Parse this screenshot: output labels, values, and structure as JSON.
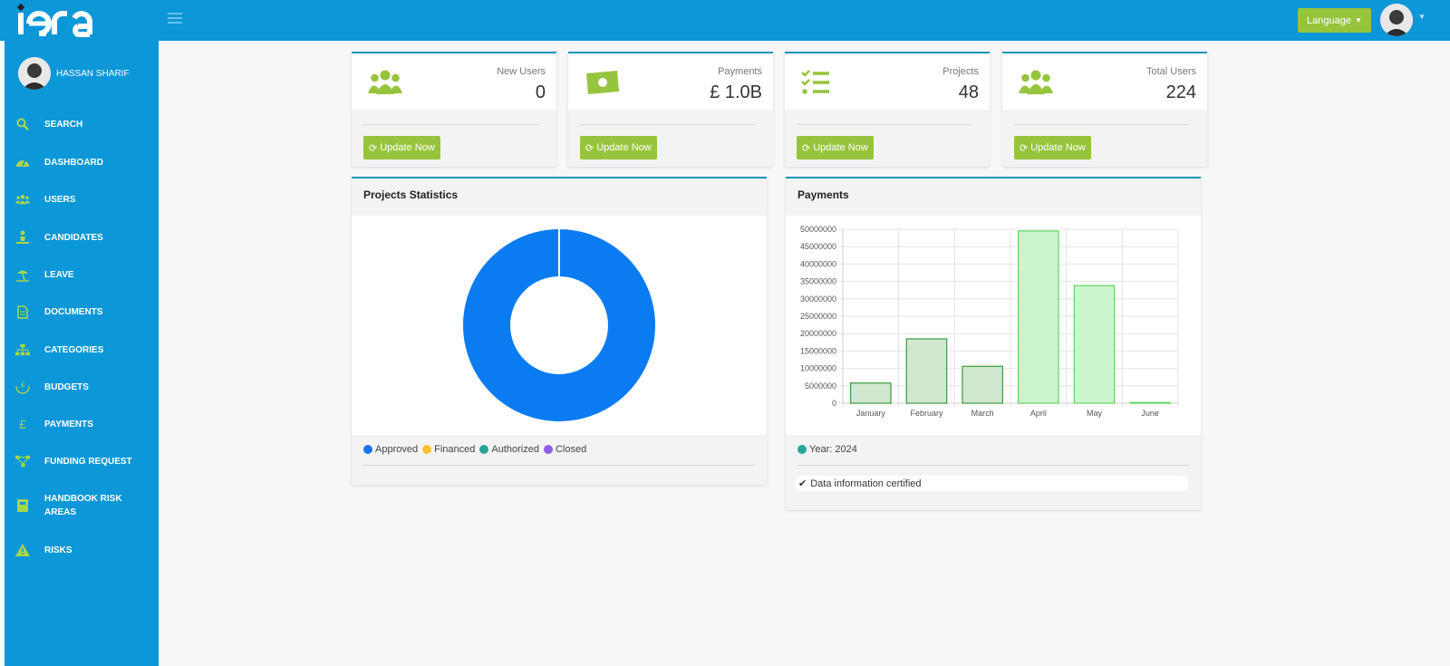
{
  "app": {
    "logo_text": "iera"
  },
  "header": {
    "language_label": "Language"
  },
  "sidebar": {
    "user_name": "HASSAN SHARIF",
    "items": [
      {
        "label": "SEARCH",
        "icon": "search-icon"
      },
      {
        "label": "DASHBOARD",
        "icon": "dashboard-icon"
      },
      {
        "label": "USERS",
        "icon": "users-icon"
      },
      {
        "label": "CANDIDATES",
        "icon": "candidate-icon"
      },
      {
        "label": "LEAVE",
        "icon": "beach-umbrella-icon"
      },
      {
        "label": "DOCUMENTS",
        "icon": "document-icon"
      },
      {
        "label": "CATEGORIES",
        "icon": "sitemap-icon"
      },
      {
        "label": "BUDGETS",
        "icon": "budget-hands-icon"
      },
      {
        "label": "PAYMENTS",
        "icon": "pound-icon"
      },
      {
        "label": "FUNDING REQUEST",
        "icon": "funding-network-icon"
      },
      {
        "label": "HANDBOOK RISK AREAS",
        "icon": "handbook-icon"
      },
      {
        "label": "RISKS",
        "icon": "warning-icon"
      }
    ]
  },
  "stats": [
    {
      "title": "New Users",
      "value": "0",
      "icon": "users-icon",
      "button": "Update Now"
    },
    {
      "title": "Payments",
      "value": "£ 1.0B",
      "icon": "money-icon",
      "button": "Update Now"
    },
    {
      "title": "Projects",
      "value": "48",
      "icon": "checklist-icon",
      "button": "Update Now"
    },
    {
      "title": "Total Users",
      "value": "224",
      "icon": "users-icon",
      "button": "Update Now"
    }
  ],
  "projects_panel": {
    "title": "Projects Statistics",
    "legend": [
      {
        "label": "Approved",
        "color": "#1a73e8"
      },
      {
        "label": "Financed",
        "color": "#fbc02d"
      },
      {
        "label": "Authorized",
        "color": "#26a69a"
      },
      {
        "label": "Closed",
        "color": "#8e5ce6"
      }
    ]
  },
  "payments_panel": {
    "title": "Payments",
    "legend_label": "Year: 2024",
    "legend_color": "#26a69a",
    "certified_text": "Data information certified"
  },
  "chart_data": [
    {
      "type": "pie",
      "title": "Projects Statistics",
      "categories": [
        "Approved",
        "Financed",
        "Authorized",
        "Closed"
      ],
      "values": [
        48,
        0,
        0,
        0
      ],
      "colors": [
        "#0a7bf0",
        "#fbc02d",
        "#26a69a",
        "#8e5ce6"
      ],
      "legend": "bottom"
    },
    {
      "type": "bar",
      "title": "Payments",
      "categories": [
        "January",
        "February",
        "March",
        "April",
        "May",
        "June"
      ],
      "series": [
        {
          "name": "Year: 2024",
          "values": [
            5800000,
            18500000,
            10600000,
            49500000,
            33800000,
            200000
          ]
        }
      ],
      "ylim": [
        0,
        50000000
      ],
      "yticks": [
        0,
        5000000,
        10000000,
        15000000,
        20000000,
        25000000,
        30000000,
        35000000,
        40000000,
        45000000,
        50000000
      ],
      "grid": true,
      "legend": "bottom-left"
    }
  ]
}
